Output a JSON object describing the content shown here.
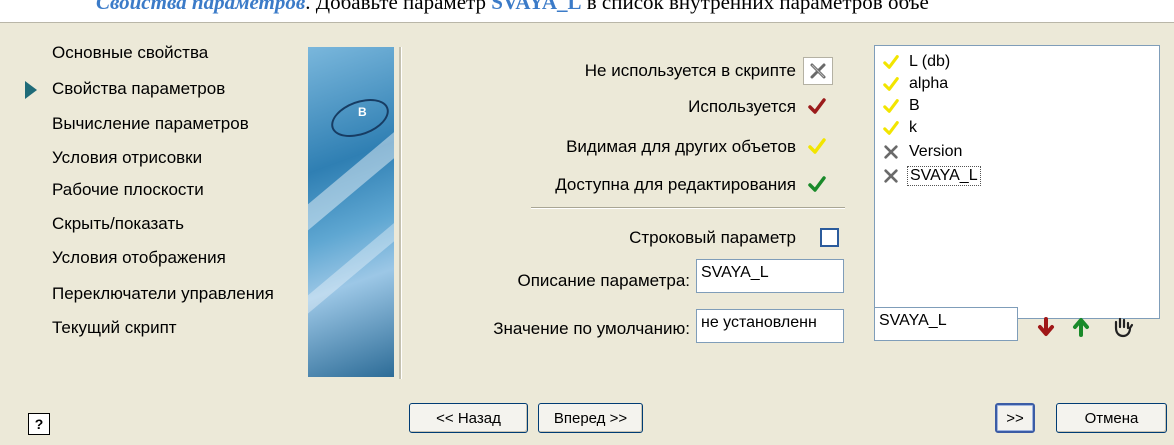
{
  "caption": {
    "part1": "Свойства параметров",
    "part2": ". Добавьте параметр ",
    "part3": "SVAYA_L",
    "part4": " в список внутренних параметров объе"
  },
  "nav": {
    "items": [
      {
        "label": "Основные свойства",
        "active": false
      },
      {
        "label": "Свойства параметров",
        "active": true
      },
      {
        "label": "Вычисление параметров",
        "active": false
      },
      {
        "label": "Условия отрисовки",
        "active": false
      },
      {
        "label": "Рабочие плоскости",
        "active": false
      },
      {
        "label": "Скрыть/показать",
        "active": false
      },
      {
        "label": "Условия отображения",
        "active": false
      },
      {
        "label": "Переключатели управления",
        "active": false
      },
      {
        "label": "Текущий скрипт",
        "active": false
      }
    ]
  },
  "image": {
    "label": "B"
  },
  "legend": {
    "not_used": {
      "label": "Не используется в скрипте",
      "icon": "x-icon"
    },
    "used": {
      "label": "Используется",
      "icon": "check-red-icon",
      "color": "#9b1b1b"
    },
    "visible": {
      "label": "Видимая для других объетов",
      "icon": "check-yellow-icon",
      "color": "#f2e500"
    },
    "editable": {
      "label": "Доступна для редактирования",
      "icon": "check-green-icon",
      "color": "#1a8a2a"
    }
  },
  "string_param": {
    "label": "Строковый параметр",
    "checked": false
  },
  "description": {
    "label": "Описание параметра:",
    "value": "SVAYA_L"
  },
  "default_value": {
    "label": "Значение по умолчанию:",
    "value": "не установленн"
  },
  "param_list": {
    "items": [
      {
        "name": "L  (db)",
        "icon": "check-yellow-icon"
      },
      {
        "name": "alpha",
        "icon": "check-yellow-icon"
      },
      {
        "name": "B",
        "icon": "check-yellow-icon"
      },
      {
        "name": "k",
        "icon": "check-yellow-icon"
      },
      {
        "name": "Version",
        "icon": "x-icon"
      },
      {
        "name": "SVAYA_L",
        "icon": "x-icon",
        "selected": true
      }
    ]
  },
  "name_input": {
    "value": "SVAYA_L"
  },
  "tools": [
    "arrow-down-icon",
    "arrow-up-icon",
    "hand-icon"
  ],
  "buttons": {
    "help": "?",
    "back": "<< Назад",
    "next": "Вперед >>",
    "finish": ">>",
    "cancel": "Отмена"
  },
  "colors": {
    "accent": "#3b7bc8",
    "nav_arrow": "#1f6b78",
    "background": "#ece9d8"
  }
}
